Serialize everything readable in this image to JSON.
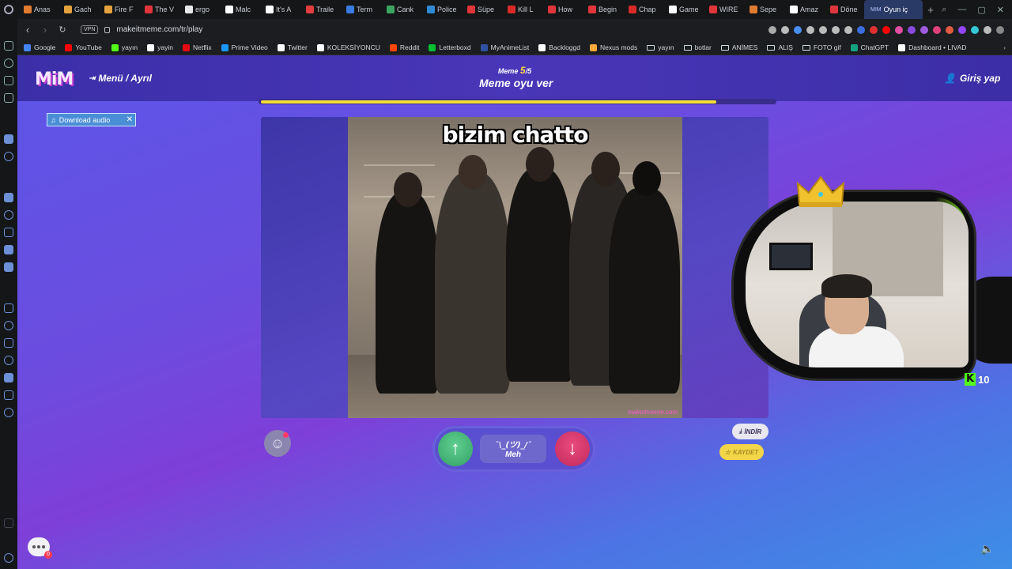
{
  "browser": {
    "tabs": [
      {
        "label": "Anas",
        "color": "#e07b2f"
      },
      {
        "label": "Gach",
        "color": "#e6a23c"
      },
      {
        "label": "Fire F",
        "color": "#e6a23c"
      },
      {
        "label": "The V",
        "color": "#e0353b"
      },
      {
        "label": "ergo",
        "color": "#e8e8e8"
      },
      {
        "label": "Malc",
        "color": "#ffffff"
      },
      {
        "label": "It's A",
        "color": "#ffffff"
      },
      {
        "label": "Traile",
        "color": "#e43d3d"
      },
      {
        "label": "Term",
        "color": "#3b7be0"
      },
      {
        "label": "Cank",
        "color": "#3da564"
      },
      {
        "label": "Police",
        "color": "#2f8ad6"
      },
      {
        "label": "Süpe",
        "color": "#e0353b"
      },
      {
        "label": "Kill L",
        "color": "#d92a2a"
      },
      {
        "label": "How",
        "color": "#e0353b"
      },
      {
        "label": "Begin",
        "color": "#e0353b"
      },
      {
        "label": "Chap",
        "color": "#d92a2a"
      },
      {
        "label": "Game",
        "color": "#ffffff"
      },
      {
        "label": "WIRE",
        "color": "#e0353b"
      },
      {
        "label": "Sepe",
        "color": "#e07b2f"
      },
      {
        "label": "Amaz",
        "color": "#ffffff"
      },
      {
        "label": "Döne",
        "color": "#e0353b"
      }
    ],
    "active_tab": {
      "label": "Oyun iç",
      "badge": "MIM"
    },
    "url": "makeitmeme.com/tr/play",
    "vpn_label": "VPN",
    "bookmarks": [
      {
        "label": "Google",
        "color": "#4285f4",
        "folder": false
      },
      {
        "label": "YouTube",
        "color": "#ff0000",
        "folder": false
      },
      {
        "label": "yayın",
        "color": "#53fc18",
        "folder": false
      },
      {
        "label": "yayin",
        "color": "#ffffff",
        "folder": false
      },
      {
        "label": "Netflix",
        "color": "#e50914",
        "folder": false
      },
      {
        "label": "Prime Video",
        "color": "#1a98ff",
        "folder": false
      },
      {
        "label": "Twitter",
        "color": "#ffffff",
        "folder": false
      },
      {
        "label": "KOLEKSİYONCU",
        "color": "#ffffff",
        "folder": false
      },
      {
        "label": "Reddit",
        "color": "#ff4500",
        "folder": false
      },
      {
        "label": "Letterboxd",
        "color": "#00c030",
        "folder": false
      },
      {
        "label": "MyAnimeList",
        "color": "#2e51a2",
        "folder": false
      },
      {
        "label": "Backloggd",
        "color": "#ffffff",
        "folder": false
      },
      {
        "label": "Nexus mods",
        "color": "#f7a93b",
        "folder": false
      },
      {
        "label": "yayın",
        "color": "",
        "folder": true
      },
      {
        "label": "botlar",
        "color": "",
        "folder": true
      },
      {
        "label": "ANİMES",
        "color": "",
        "folder": true
      },
      {
        "label": "ALIŞ",
        "color": "",
        "folder": true
      },
      {
        "label": "FOTO gif",
        "color": "",
        "folder": true
      },
      {
        "label": "ChatGPT",
        "color": "#10a37f",
        "folder": false
      },
      {
        "label": "Dashboard • LIVAD",
        "color": "#ffffff",
        "folder": false
      }
    ]
  },
  "header": {
    "logo": "MiM",
    "menu_label": "Menü / Ayrıl",
    "meme_label": "Meme",
    "meme_current": "5",
    "meme_total": "/5",
    "title": "Meme oyu ver",
    "login_label": "Giriş yap"
  },
  "progress": {
    "value": 0.88,
    "color": "#f3df37"
  },
  "tooltip": {
    "download_audio": "Download audio"
  },
  "meme": {
    "caption": "bizim chatto",
    "watermark": "makeitmeme.com"
  },
  "vote": {
    "meh_face": "¯\\_(ツ)_/¯",
    "meh_label": "Meh"
  },
  "actions": {
    "download_label": "İNDİR",
    "save_label": "KAYDET"
  },
  "chat": {
    "badge": "0"
  },
  "overlay": {
    "kick_count": "10",
    "kick_color": "#53fc18"
  }
}
